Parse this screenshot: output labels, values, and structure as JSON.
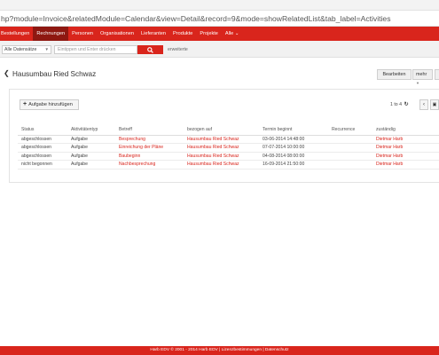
{
  "browser": {
    "url_text": "hp?module=Invoice&relatedModule=Calendar&view=Detail&record=9&mode=showRelatedList&tab_label=Activities"
  },
  "nav": {
    "items": [
      "Bestellungen",
      "Rechnungen",
      "Personen",
      "Organisationen",
      "Lieferanten",
      "Produkte",
      "Projekte",
      "Alle"
    ],
    "active_index": 1,
    "dropdown_caret": "⌄"
  },
  "search": {
    "scope_value": "Alle Datensätze",
    "placeholder": "Eintippen und Enter drücken",
    "button_icon": "search-icon",
    "advanced_label": "erweiterte"
  },
  "record": {
    "back_icon": "chevron-left-icon",
    "title": "Hausumbau Ried Schwaz",
    "edit_label": "Bearbeiten",
    "more_label": "mehr"
  },
  "related": {
    "add_label": "Aufgabe hinzufügen",
    "pager_text": "1 to 4",
    "refresh_icon": "refresh-icon",
    "prev_icon": "chevron-left-icon",
    "columns": [
      "Status",
      "Aktivitätentyp",
      "Betreff",
      "bezogen auf",
      "Termin beginnt",
      "Recurrence",
      "zuständig"
    ],
    "rows": [
      [
        "abgeschlossen",
        "Aufgabe",
        "Besprechung",
        "Hausumbau Ried Schwaz",
        "03-06-2014 14:48:00",
        "",
        "Dietmar Harb"
      ],
      [
        "abgeschlossen",
        "Aufgabe",
        "Einreichung der Pläne",
        "Hausumbau Ried Schwaz",
        "07-07-2014 10:00:00",
        "",
        "Dietmar Harb"
      ],
      [
        "abgeschlossen",
        "Aufgabe",
        "Baubeginn",
        "Hausumbau Ried Schwaz",
        "04-08-2014 08:00:00",
        "",
        "Dietmar Harb"
      ],
      [
        "nicht begonnen",
        "Aufgabe",
        "Nachbesprechung",
        "Hausumbau Ried Schwaz",
        "16-09-2014 21:50:00",
        "",
        "Dietmar Harb"
      ]
    ]
  },
  "footer": {
    "text": "Harb EDV  © 2001 - 2014  Harb EDV | Lizenzbestimmungen | Datenschutz"
  },
  "colors": {
    "brand_red": "#d9251c",
    "active_nav": "#8e1811",
    "link": "#d9251c"
  }
}
